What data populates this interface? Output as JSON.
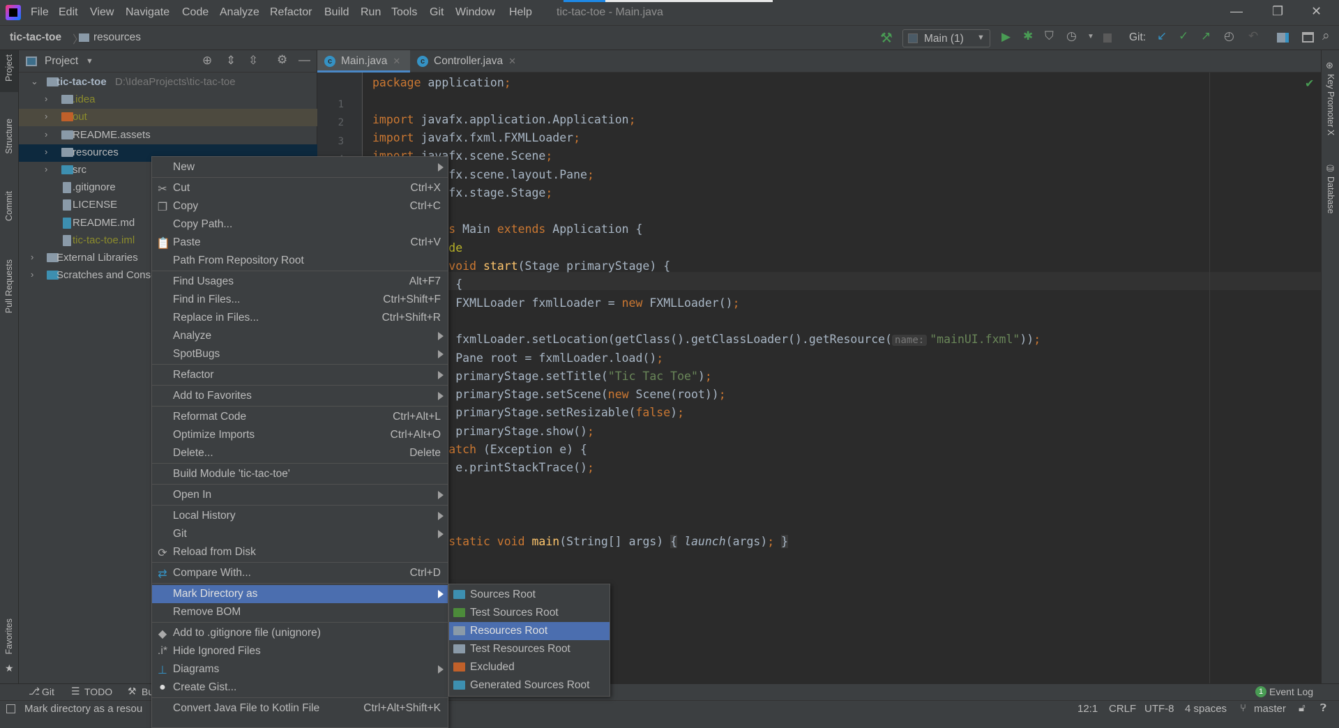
{
  "window": {
    "title": "tic-tac-toe - Main.java",
    "minimize": "—",
    "restore": "❐",
    "close": "✕"
  },
  "menubar": [
    "File",
    "Edit",
    "View",
    "Navigate",
    "Code",
    "Analyze",
    "Refactor",
    "Build",
    "Run",
    "Tools",
    "Git",
    "Window",
    "Help"
  ],
  "breadcrumb": {
    "project": "tic-tac-toe",
    "folder": "resources"
  },
  "toolbar": {
    "run_config": "Main (1)",
    "git_label": "Git:"
  },
  "left_stripe": {
    "project": "Project",
    "structure": "Structure",
    "commit": "Commit",
    "pull_requests": "Pull Requests",
    "favorites": "Favorites"
  },
  "right_stripe": {
    "key_promoter": "Key Promoter X",
    "database": "Database"
  },
  "project_panel": {
    "title": "Project",
    "tree": [
      {
        "label": "tic-tac-toe",
        "path": "D:\\IdeaProjects\\tic-tac-toe",
        "level": 0,
        "arrow": "⌄",
        "icon": "module-folder-icon",
        "color": "#a9b7c6",
        "bold": true
      },
      {
        "label": ".idea",
        "level": 1,
        "arrow": "›",
        "icon": "folder-icon",
        "color": "#8c8c2c"
      },
      {
        "label": "out",
        "level": 1,
        "arrow": "›",
        "icon": "excluded-folder-icon",
        "color": "#8c8c2c",
        "highlight": "#4d4a3f"
      },
      {
        "label": "README.assets",
        "level": 1,
        "arrow": "›",
        "icon": "folder-icon",
        "color": "#bbbbbb"
      },
      {
        "label": "resources",
        "level": 1,
        "arrow": "›",
        "icon": "folder-icon",
        "color": "#bbbbbb",
        "selected": true
      },
      {
        "label": "src",
        "level": 1,
        "arrow": "›",
        "icon": "source-folder-icon",
        "color": "#bbbbbb"
      },
      {
        "label": ".gitignore",
        "level": 1,
        "icon": "text-file-icon",
        "color": "#bbbbbb"
      },
      {
        "label": "LICENSE",
        "level": 1,
        "icon": "text-file-icon",
        "color": "#bbbbbb"
      },
      {
        "label": "README.md",
        "level": 1,
        "icon": "markdown-file-icon",
        "color": "#bbbbbb"
      },
      {
        "label": "tic-tac-toe.iml",
        "level": 1,
        "icon": "iml-file-icon",
        "color": "#8c8c2c"
      },
      {
        "label": "External Libraries",
        "level": 0,
        "arrow": "›",
        "icon": "libraries-icon",
        "color": "#bbbbbb"
      },
      {
        "label": "Scratches and Consoles",
        "level": 0,
        "arrow": "›",
        "icon": "scratches-icon",
        "color": "#bbbbbb"
      }
    ]
  },
  "tabs": [
    {
      "label": "Main.java",
      "active": true
    },
    {
      "label": "Controller.java",
      "active": false
    }
  ],
  "editor": {
    "caret_line": 12,
    "lines": [
      [
        [
          "k",
          "package"
        ],
        [
          "t",
          " application"
        ],
        [
          "k",
          ";"
        ]
      ],
      [],
      [
        [
          "k",
          "import"
        ],
        [
          "t",
          " javafx.application.Application"
        ],
        [
          "k",
          ";"
        ]
      ],
      [
        [
          "k",
          "import"
        ],
        [
          "t",
          " javafx.fxml.FXMLLoader"
        ],
        [
          "k",
          ";"
        ]
      ],
      [
        [
          "k",
          "import"
        ],
        [
          "t",
          " javafx.scene.Scene"
        ],
        [
          "k",
          ";"
        ]
      ],
      [
        [
          "k",
          "import"
        ],
        [
          "t",
          " javafx.scene.layout.Pane"
        ],
        [
          "k",
          ";"
        ]
      ],
      [
        [
          "k",
          "import"
        ],
        [
          "t",
          " javafx.stage.Stage"
        ],
        [
          "k",
          ";"
        ]
      ],
      [],
      [
        [
          "k",
          "public class"
        ],
        [
          "t",
          " Main "
        ],
        [
          "k",
          "extends"
        ],
        [
          "t",
          " Application {"
        ]
      ],
      [
        [
          "a",
          "    @Override"
        ]
      ],
      [
        [
          "k",
          "    public void "
        ],
        [
          "m",
          "start"
        ],
        [
          "t",
          "(Stage primaryStage) {"
        ]
      ],
      [
        [
          "k",
          "        try"
        ],
        [
          "t",
          " {"
        ]
      ],
      [
        [
          "t",
          "            FXMLLoader fxmlLoader = "
        ],
        [
          "k",
          "new"
        ],
        [
          "t",
          " FXMLLoader()"
        ],
        [
          "k",
          ";"
        ]
      ],
      [],
      [
        [
          "t",
          "            fxmlLoader.setLocation(getClass().getClassLoader().getResource("
        ],
        [
          "h",
          "name:"
        ],
        [
          "s",
          "\"mainUI.fxml\""
        ],
        [
          "t",
          "))"
        ],
        [
          "k",
          ";"
        ]
      ],
      [
        [
          "t",
          "            Pane root = fxmlLoader.load()"
        ],
        [
          "k",
          ";"
        ]
      ],
      [
        [
          "t",
          "            primaryStage.setTitle("
        ],
        [
          "s",
          "\"Tic Tac Toe\""
        ],
        [
          "t",
          ")"
        ],
        [
          "k",
          ";"
        ]
      ],
      [
        [
          "t",
          "            primaryStage.setScene("
        ],
        [
          "k",
          "new"
        ],
        [
          "t",
          " Scene(root))"
        ],
        [
          "k",
          ";"
        ]
      ],
      [
        [
          "t",
          "            primaryStage.setResizable("
        ],
        [
          "k",
          "false"
        ],
        [
          "t",
          ")"
        ],
        [
          "k",
          ";"
        ]
      ],
      [
        [
          "t",
          "            primaryStage.show()"
        ],
        [
          "k",
          ";"
        ]
      ],
      [
        [
          "t",
          "        } "
        ],
        [
          "k",
          "catch"
        ],
        [
          "t",
          " (Exception e) {"
        ]
      ],
      [
        [
          "t",
          "            e.printStackTrace()"
        ],
        [
          "k",
          ";"
        ]
      ],
      [
        [
          "t",
          "        }"
        ]
      ],
      [
        [
          "t",
          "    }"
        ]
      ],
      [],
      [
        [
          "k",
          "    public static void "
        ],
        [
          "m",
          "main"
        ],
        [
          "t",
          "(String[] args) "
        ],
        [
          "b",
          "{"
        ],
        [
          "t",
          " "
        ],
        [
          "i",
          "launch"
        ],
        [
          "t",
          "(args)"
        ],
        [
          "k",
          ";"
        ],
        [
          "t",
          " "
        ],
        [
          "b",
          "}"
        ]
      ],
      [
        [
          "t",
          "}"
        ]
      ]
    ]
  },
  "context_menu": [
    {
      "label": "New",
      "submenu": true
    },
    {
      "sep": true
    },
    {
      "label": "Cut",
      "shortcut": "Ctrl+X",
      "icon": "✂",
      "iname": "scissors-icon"
    },
    {
      "label": "Copy",
      "shortcut": "Ctrl+C",
      "icon": "❐",
      "iname": "copy-icon"
    },
    {
      "label": "Copy Path..."
    },
    {
      "label": "Paste",
      "shortcut": "Ctrl+V",
      "icon": "📋",
      "iname": "clipboard-icon"
    },
    {
      "label": "Path From Repository Root"
    },
    {
      "sep": true
    },
    {
      "label": "Find Usages",
      "shortcut": "Alt+F7"
    },
    {
      "label": "Find in Files...",
      "shortcut": "Ctrl+Shift+F"
    },
    {
      "label": "Replace in Files...",
      "shortcut": "Ctrl+Shift+R"
    },
    {
      "label": "Analyze",
      "submenu": true
    },
    {
      "label": "SpotBugs",
      "submenu": true
    },
    {
      "sep": true
    },
    {
      "label": "Refactor",
      "submenu": true
    },
    {
      "sep": true
    },
    {
      "label": "Add to Favorites",
      "submenu": true
    },
    {
      "sep": true
    },
    {
      "label": "Reformat Code",
      "shortcut": "Ctrl+Alt+L"
    },
    {
      "label": "Optimize Imports",
      "shortcut": "Ctrl+Alt+O"
    },
    {
      "label": "Delete...",
      "shortcut": "Delete"
    },
    {
      "sep": true
    },
    {
      "label": "Build Module 'tic-tac-toe'"
    },
    {
      "sep": true
    },
    {
      "label": "Open In",
      "submenu": true
    },
    {
      "sep": true
    },
    {
      "label": "Local History",
      "submenu": true
    },
    {
      "label": "Git",
      "submenu": true
    },
    {
      "label": "Reload from Disk",
      "icon": "⟳",
      "iname": "reload-icon"
    },
    {
      "sep": true
    },
    {
      "label": "Compare With...",
      "shortcut": "Ctrl+D",
      "icon": "⇄",
      "iname": "compare-icon",
      "icolor": "#3592c4"
    },
    {
      "sep": true
    },
    {
      "label": "Mark Directory as",
      "submenu": true,
      "selected": true
    },
    {
      "label": "Remove BOM"
    },
    {
      "sep": true
    },
    {
      "label": "Add to .gitignore file (unignore)",
      "icon": "◆",
      "iname": "git-diamond-icon"
    },
    {
      "label": "Hide Ignored Files",
      "icon": ".i*",
      "iname": "ignored-files-icon"
    },
    {
      "label": "Diagrams",
      "submenu": true,
      "icon": "⊥",
      "iname": "diagram-icon",
      "icolor": "#3592c4"
    },
    {
      "label": "Create Gist...",
      "icon": "●",
      "iname": "github-icon",
      "icolor": "#dddddd"
    },
    {
      "sep": true
    },
    {
      "label": "Convert Java File to Kotlin File",
      "shortcut": "Ctrl+Alt+Shift+K"
    }
  ],
  "submenu": [
    {
      "label": "Sources Root",
      "color": "#3d8fb0",
      "iname": "sources-root-icon"
    },
    {
      "label": "Test Sources Root",
      "color": "#4c8b3a",
      "iname": "test-sources-root-icon"
    },
    {
      "label": "Resources Root",
      "color": "#8a9aa8",
      "iname": "resources-root-icon",
      "selected": true
    },
    {
      "label": "Test Resources Root",
      "color": "#8a9aa8",
      "iname": "test-resources-root-icon"
    },
    {
      "label": "Excluded",
      "color": "#c0602a",
      "iname": "excluded-icon"
    },
    {
      "label": "Generated Sources Root",
      "color": "#3d8fb0",
      "iname": "generated-sources-root-icon"
    }
  ],
  "bottom_tools": {
    "git": "Git",
    "todo": "TODO",
    "build": "Bu",
    "event_log": "Event Log",
    "event_count": "1"
  },
  "status": {
    "message": "Mark directory as a resou",
    "position": "12:1",
    "line_sep": "CRLF",
    "encoding": "UTF-8",
    "indent": "4 spaces",
    "branch": "master"
  },
  "colors": {
    "accent": "#4b6eaf",
    "tree_selected": "#0d293e",
    "run_green": "#499c54",
    "keyword": "#cc7832",
    "string": "#6a8759"
  }
}
